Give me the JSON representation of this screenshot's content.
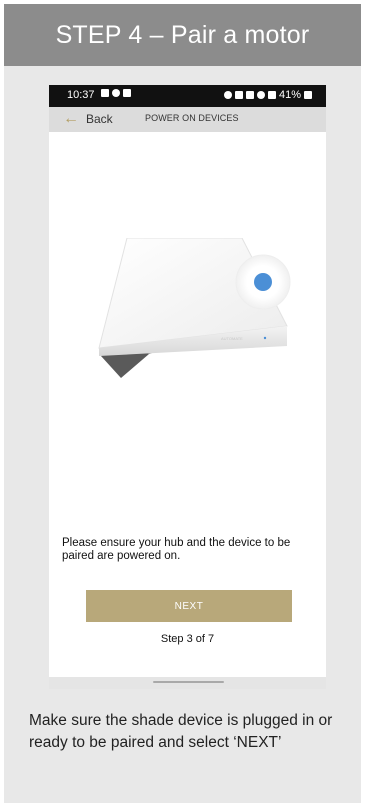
{
  "header": {
    "title": "STEP 4 – Pair a motor"
  },
  "phone": {
    "status_bar": {
      "time": "10:37",
      "battery": "41%",
      "left_icons": [
        "gallery-icon",
        "notification-icon",
        "flag-icon"
      ],
      "right_icons": [
        "alarm-icon",
        "bluetooth-icon",
        "mute-icon",
        "wifi-icon",
        "lte-signal-icon"
      ]
    },
    "appbar": {
      "back_label": "Back",
      "title": "POWER ON DEVICES"
    },
    "hub_image": {
      "brand_text": "AUTOMATE"
    },
    "instruction": "Please ensure your hub and the device to be paired are powered on.",
    "next_label": "NEXT",
    "step_count": "Step 3 of 7"
  },
  "caption": "Make sure the shade device is plugged in or ready to be paired and select ‘NEXT’",
  "colors": {
    "header_bg": "#8c8c8c",
    "card_bg": "#e8e8e8",
    "accent_gold": "#b8a87a",
    "back_arrow": "#b39e63",
    "hub_dot_blue": "#4b8fd6"
  }
}
